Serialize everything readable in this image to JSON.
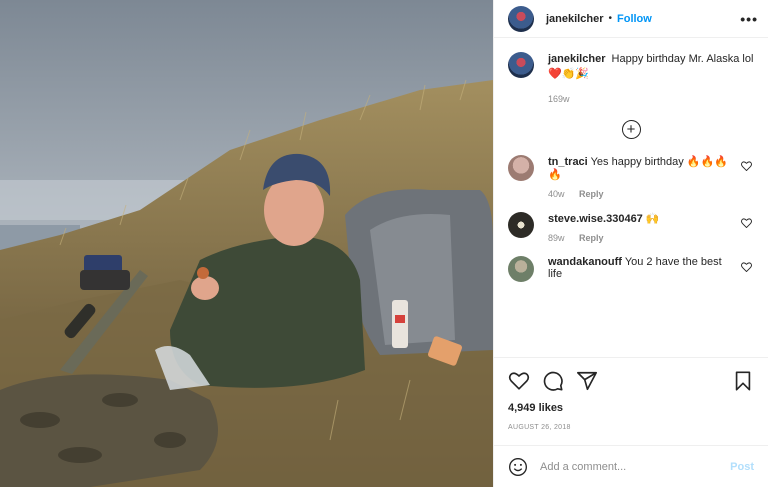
{
  "post": {
    "username": "janekilcher",
    "follow_label": "Follow",
    "separator": "•",
    "more_label": "•••",
    "caption": {
      "username": "janekilcher",
      "text": "Happy birthday Mr. Alaska lol ❤️👏🎉",
      "time": "169w"
    },
    "load_more_label": "+",
    "comments": [
      {
        "username": "tn_traci",
        "text": "Yes happy birthday 🔥🔥🔥🔥",
        "time": "40w",
        "reply_label": "Reply",
        "avatar_color": "#b89890"
      },
      {
        "username": "steve.wise.330467",
        "text": "🙌",
        "time": "89w",
        "reply_label": "Reply",
        "avatar_color": "#2d2b26"
      },
      {
        "username": "wandakanouff",
        "text": "You 2 have the best life",
        "time": "",
        "reply_label": "",
        "avatar_color": "#6e7f68"
      }
    ],
    "likes": "4,949 likes",
    "date": "AUGUST 26, 2018",
    "comment_placeholder": "Add a comment...",
    "post_label": "Post"
  },
  "icons": {
    "like": "heart-icon",
    "comment": "comment-icon",
    "share": "share-icon",
    "save": "bookmark-icon",
    "emoji": "smiley-icon",
    "comment_like": "small-heart-icon"
  },
  "colors": {
    "accent": "#0095f6",
    "post_disabled": "#b2dffc",
    "muted": "#8e8e8e",
    "text": "#262626"
  }
}
